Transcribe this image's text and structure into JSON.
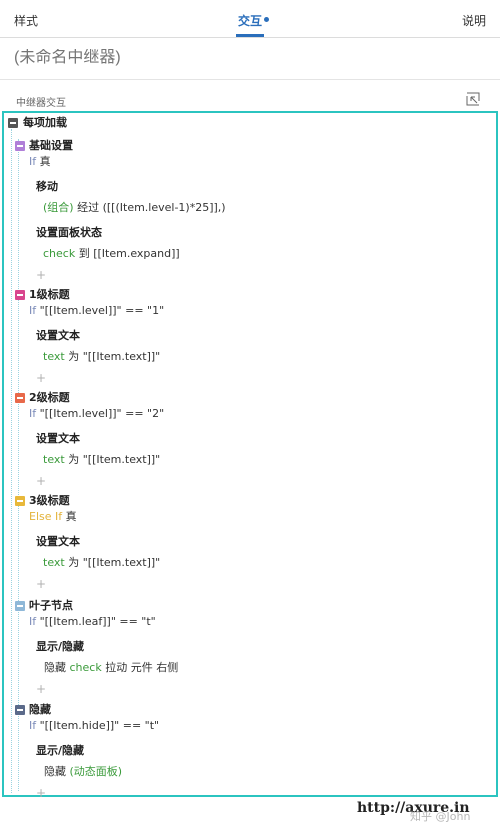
{
  "tabs": {
    "style": "样式",
    "interaction": "交互",
    "notes": "说明"
  },
  "name_placeholder": "(未命名中继器)",
  "section_title": "中继器交互",
  "tree": {
    "root": {
      "label": "每项加载",
      "color": "#555555"
    },
    "cases": [
      {
        "title": "基础设置",
        "color": "#b07fd8",
        "cond_kw": "If",
        "cond": "真",
        "cond_kw_class": "kw",
        "actions": [
          {
            "name": "移动",
            "detail_green": "(组合)",
            "detail": "经过 ([[(Item.level-1)*25]],)"
          },
          {
            "name": "设置面板状态",
            "detail_green": "check",
            "detail": "到 [[Item.expand]]"
          }
        ]
      },
      {
        "title": "1级标题",
        "color": "#d9468e",
        "cond_kw": "If",
        "cond": "\"[[Item.level]]\" == \"1\"",
        "cond_kw_class": "kw",
        "actions": [
          {
            "name": "设置文本",
            "detail_green": "text",
            "detail": "为 \"[[Item.text]]\""
          }
        ]
      },
      {
        "title": "2级标题",
        "color": "#e8694a",
        "cond_kw": "If",
        "cond": "\"[[Item.level]]\" == \"2\"",
        "cond_kw_class": "kw",
        "actions": [
          {
            "name": "设置文本",
            "detail_green": "text",
            "detail": "为 \"[[Item.text]]\""
          }
        ]
      },
      {
        "title": "3级标题",
        "color": "#e8b83a",
        "cond_kw": "Else If",
        "cond": "真",
        "cond_kw_class": "kw-else",
        "actions": [
          {
            "name": "设置文本",
            "detail_green": "text",
            "detail": "为 \"[[Item.text]]\""
          }
        ]
      },
      {
        "title": "叶子节点",
        "color": "#8fb8d8",
        "cond_kw": "If",
        "cond": "\"[[Item.leaf]]\" == \"t\"",
        "cond_kw_class": "kw",
        "actions": [
          {
            "name": "显示/隐藏",
            "detail_pre": "隐藏",
            "detail_green": "check",
            "detail": "拉动 元件 右侧"
          }
        ]
      },
      {
        "title": "隐藏",
        "color": "#5b6a8a",
        "cond_kw": "If",
        "cond": "\"[[Item.hide]]\" == \"t\"",
        "cond_kw_class": "kw",
        "actions": [
          {
            "name": "显示/隐藏",
            "detail_pre": "隐藏",
            "detail_green": "(动态面板)",
            "detail": ""
          }
        ]
      }
    ],
    "plus": "+"
  },
  "footer": {
    "site": "http://axure.in",
    "watermark": "知乎 @John"
  },
  "colors": {
    "accent": "#2a6ebb",
    "panel_border": "#2bc4c0",
    "green": "#3a9a3a"
  }
}
